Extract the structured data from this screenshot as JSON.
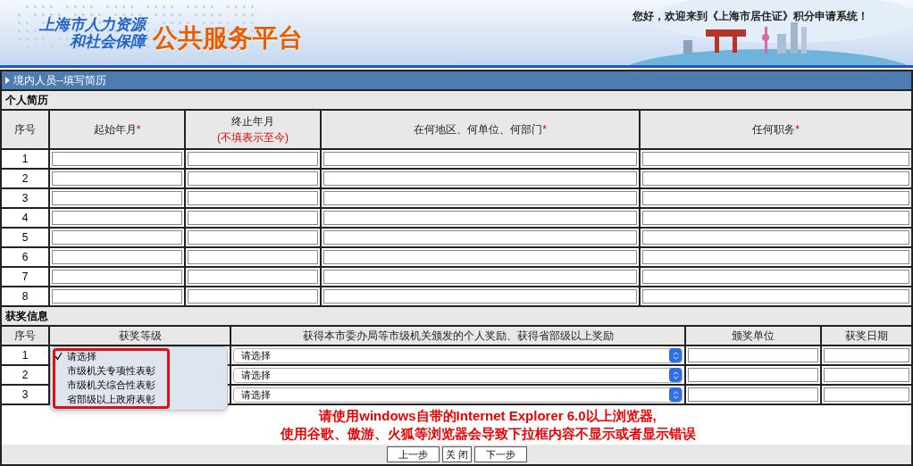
{
  "header": {
    "title_line1": "上海市人力资源",
    "title_line2": "和社会保障",
    "platform": "公共服务平台",
    "welcome": "您好，欢迎来到《上海市居住证》积分申请系统！"
  },
  "page_title": "境内人员--填写简历",
  "resume": {
    "section": "个人简历",
    "columns": [
      {
        "label": "序号"
      },
      {
        "label": "起始年月",
        "mark": "*"
      },
      {
        "label": "终止年月",
        "note": "(不填表示至今)"
      },
      {
        "label": "在何地区、何单位、何部门",
        "mark": "*"
      },
      {
        "label": "任何职务",
        "mark": "*"
      }
    ],
    "rows": [
      "1",
      "2",
      "3",
      "4",
      "5",
      "6",
      "7",
      "8"
    ]
  },
  "awards": {
    "section": "获奖信息",
    "columns": [
      "序号",
      "获奖等级",
      "获得本市委办局等市级机关颁发的个人奖励、获得省部级以上奖励",
      "颁奖单位",
      "获奖日期"
    ],
    "rows": [
      {
        "number": "1",
        "award": "请选择"
      },
      {
        "number": "2",
        "award": "请选择"
      },
      {
        "number": "3",
        "award": "请选择"
      }
    ],
    "open_dropdown": [
      {
        "label": "请选择",
        "selected": true
      },
      {
        "label": "市级机关专项性表彰",
        "selected": false
      },
      {
        "label": "市级机关综合性表彰",
        "selected": false
      },
      {
        "label": "省部级以上政府表彰",
        "selected": false
      }
    ]
  },
  "notice": [
    "请使用windows自带的Internet Explorer 6.0以上浏览器,",
    "使用谷歌、傲游、火狐等浏览器会导致下拉框内容不显示或者显示错误"
  ],
  "buttons": [
    "上一步",
    "关 闭",
    "下一步"
  ]
}
